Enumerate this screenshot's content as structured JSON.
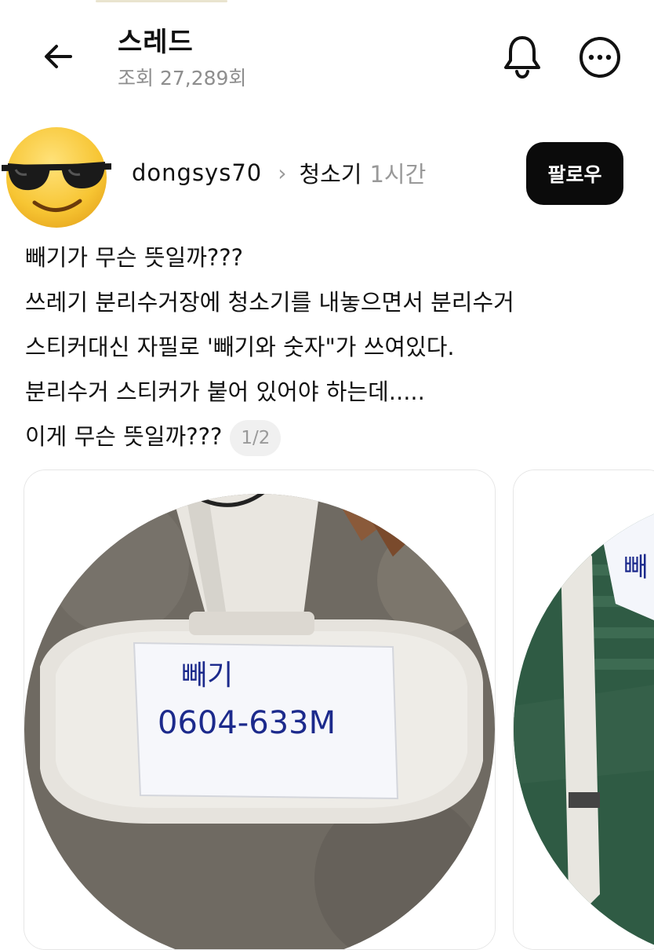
{
  "header": {
    "title": "스레드",
    "views": "조회 27,289회",
    "back_icon": "arrow-left-icon",
    "bell_icon": "bell-icon",
    "more_icon": "more-horizontal-icon"
  },
  "post": {
    "username": "dongsys70",
    "topic": "청소기",
    "time": "1시간",
    "follow_label": "팔로우",
    "lines": [
      "빼기가 무슨 뜻일까???",
      "쓰레기 분리수거장에 청소기를 내놓으면서 분리수거",
      "스티커대신 자필로 '빼기와 숫자\"가 쓰여있다.",
      "분리수거 스티커가 붙어 있어야 하는데.....",
      "이게 무슨 뜻일까???"
    ],
    "page_indicator": "1/2",
    "image1_note_line1": "빼기",
    "image1_note_line2": "0604-633M",
    "image2_note": "빼"
  },
  "colors": {
    "follow_bg": "#0b0b0b",
    "muted": "#8e8e8e",
    "emoji_yellow": "#f7c533"
  }
}
